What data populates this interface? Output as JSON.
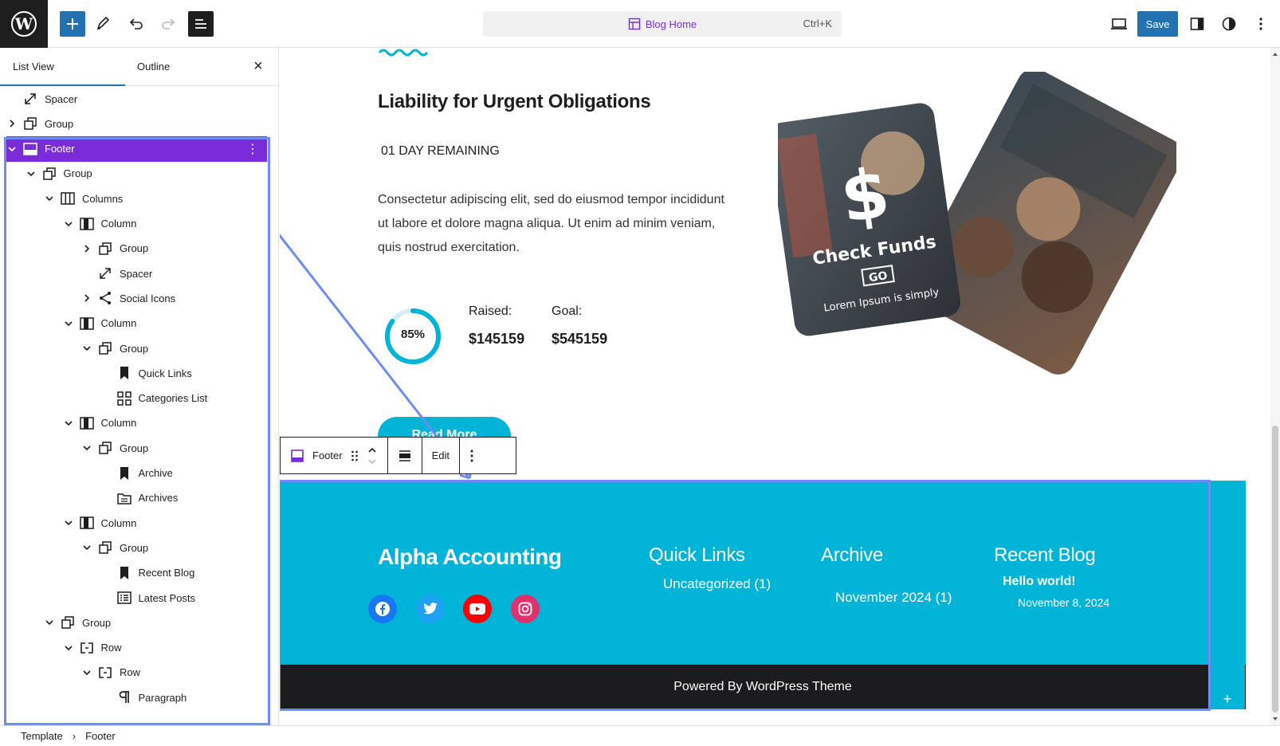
{
  "topbar": {
    "command": {
      "title": "Blog Home",
      "shortcut": "Ctrl+K"
    },
    "save_label": "Save"
  },
  "sidebar": {
    "tab_list": "List View",
    "tab_outline": "Outline",
    "tree": [
      {
        "label": "Spacer",
        "icon": "spacer-icon",
        "depth": 0,
        "chevron": "none"
      },
      {
        "label": "Group",
        "icon": "group-icon",
        "depth": 0,
        "chevron": "right"
      },
      {
        "label": "Footer",
        "icon": "template-part-icon",
        "depth": 0,
        "chevron": "down",
        "selected": true
      },
      {
        "label": "Group",
        "icon": "group-icon",
        "depth": 1,
        "chevron": "down"
      },
      {
        "label": "Columns",
        "icon": "columns-icon",
        "depth": 2,
        "chevron": "down"
      },
      {
        "label": "Column",
        "icon": "column-icon",
        "depth": 3,
        "chevron": "down"
      },
      {
        "label": "Group",
        "icon": "group-icon",
        "depth": 4,
        "chevron": "right"
      },
      {
        "label": "Spacer",
        "icon": "spacer-icon",
        "depth": 4,
        "chevron": "none"
      },
      {
        "label": "Social Icons",
        "icon": "share-icon",
        "depth": 4,
        "chevron": "right"
      },
      {
        "label": "Column",
        "icon": "column-icon",
        "depth": 3,
        "chevron": "down"
      },
      {
        "label": "Group",
        "icon": "group-icon",
        "depth": 4,
        "chevron": "down"
      },
      {
        "label": "Quick Links",
        "icon": "bookmark-icon",
        "depth": 5,
        "chevron": "none"
      },
      {
        "label": "Categories List",
        "icon": "categories-icon",
        "depth": 5,
        "chevron": "none"
      },
      {
        "label": "Column",
        "icon": "column-icon",
        "depth": 3,
        "chevron": "down"
      },
      {
        "label": "Group",
        "icon": "group-icon",
        "depth": 4,
        "chevron": "down"
      },
      {
        "label": "Archive",
        "icon": "bookmark-icon",
        "depth": 5,
        "chevron": "none"
      },
      {
        "label": "Archives",
        "icon": "archive-icon",
        "depth": 5,
        "chevron": "none"
      },
      {
        "label": "Column",
        "icon": "column-icon",
        "depth": 3,
        "chevron": "down"
      },
      {
        "label": "Group",
        "icon": "group-icon",
        "depth": 4,
        "chevron": "down"
      },
      {
        "label": "Recent Blog",
        "icon": "bookmark-icon",
        "depth": 5,
        "chevron": "none"
      },
      {
        "label": "Latest Posts",
        "icon": "list-icon",
        "depth": 5,
        "chevron": "none"
      },
      {
        "label": "Group",
        "icon": "group-icon",
        "depth": 2,
        "chevron": "down"
      },
      {
        "label": "Row",
        "icon": "row-icon",
        "depth": 3,
        "chevron": "down"
      },
      {
        "label": "Row",
        "icon": "row-icon",
        "depth": 4,
        "chevron": "down"
      },
      {
        "label": "Paragraph",
        "icon": "paragraph-icon",
        "depth": 5,
        "chevron": "none"
      }
    ]
  },
  "canvas": {
    "heading": "Liability for Urgent Obligations",
    "days": "01 DAY REMAINING",
    "paragraph": "Consectetur adipiscing elit, sed do eiusmod tempor incididunt ut labore et dolore magna aliqua. Ut enim ad minim veniam, quis nostrud exercitation.",
    "progress_label": "85%",
    "progress_value": 0.85,
    "raised_label": "Raised:",
    "raised_value": "$145159",
    "goal_label": "Goal:",
    "goal_value": "$545159",
    "read_more": "Read More",
    "hero": {
      "main": "$",
      "check": "Check Funds",
      "go": "GO",
      "lorem": "Lorem Ipsum is simply"
    },
    "accent": "#00b4d8"
  },
  "block_toolbar": {
    "block_name": "Footer",
    "edit_label": "Edit"
  },
  "footer": {
    "brand": "Alpha Accounting",
    "quick_links_title": "Quick Links",
    "quick_links_item": "Uncategorized (1)",
    "archive_title": "Archive",
    "archive_item": "November 2024 (1)",
    "recent_title": "Recent Blog",
    "recent_post": "Hello world!",
    "recent_date": "November 8, 2024",
    "bottom_text": "Powered By WordPress Theme"
  },
  "breadcrumb": {
    "root": "Template",
    "current": "Footer"
  },
  "colors": {
    "selection": "#7a2dd6",
    "primary": "#2271b1",
    "frame": "#6e8cf5"
  }
}
